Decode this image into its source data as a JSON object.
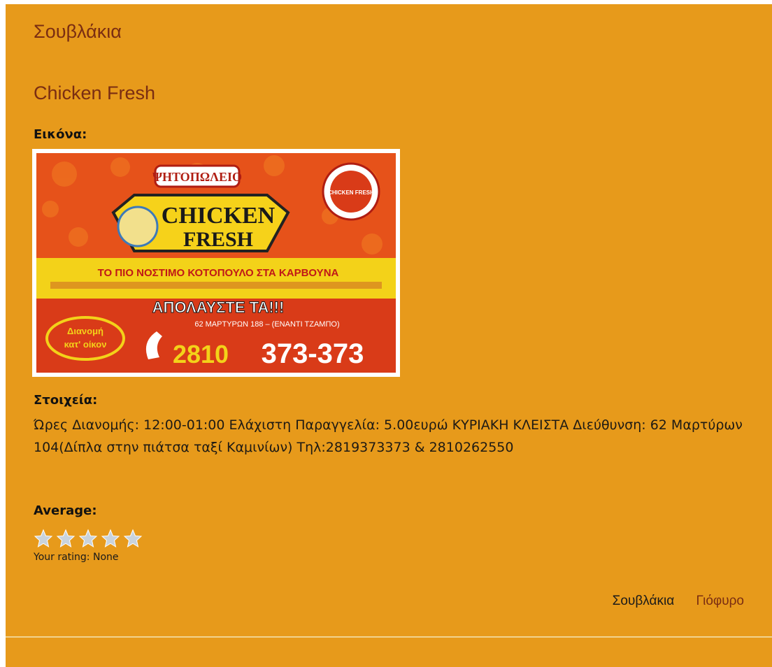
{
  "category": {
    "title": "Σουβλάκια"
  },
  "node": {
    "title": "Chicken Fresh",
    "image_label": "Εικόνα:",
    "image": {
      "heading_top": "ΨΗΤΟΠΩΛΕΙΟ",
      "brand_line1": "CHICKEN",
      "brand_line2": "FRESH",
      "badge": "CHICKEN FRESH",
      "slogan": "ΤΟ ΠΙΟ ΝΟΣΤΙΜΟ ΚΟΤΟΠΟΥΛΟ ΣΤΑ ΚΑΡΒΟΥΝΑ",
      "enjoy": "ΑΠΟΛΑΥΣΤΕ ΤΑ!!!",
      "delivery_line1": "Διανομή",
      "delivery_line2": "κατ' οίκον",
      "address": "62 ΜΑΡΤΥΡΩΝ 188 – (ΕΝΑΝΤΙ ΤΖΑΜΠΟ)",
      "phone_prefix": "2810",
      "phone_number": "373-373"
    },
    "details_label": "Στοιχεία:",
    "details_text": "Ώρες Διανομής: 12:00-01:00 Ελάχιστη Παραγγελία: 5.00ευρώ ΚΥΡΙΑΚΗ ΚΛΕΙΣΤΑ Διεύθυνση: 62 Μαρτύρων 104(Δίπλα στην πιάτσα ταξί Καμινίων) Τηλ:2819373373 & 2810262550",
    "average_label": "Average:",
    "rating": {
      "max_stars": 5,
      "average_stars": 0,
      "your_rating": "Your rating: None"
    }
  },
  "nav": {
    "links": [
      {
        "label": "Σουβλάκια",
        "color": "#1a1a1a"
      },
      {
        "label": "Γιόφυρο",
        "color": "#7a2d12"
      }
    ]
  },
  "colors": {
    "background": "#e79a1b",
    "title": "#7a2d12",
    "star": "#c9d3dc",
    "divider": "#f1d28f"
  }
}
